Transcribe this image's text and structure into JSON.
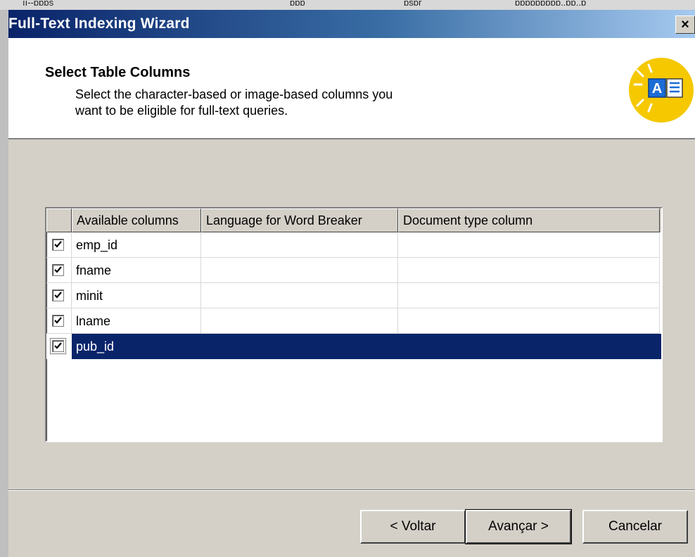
{
  "background_window": {
    "cells": [
      "ıı--ɒɒɒs",
      "ɒɒɒ",
      "ɒsɒr",
      "ɒɒɒɒɒɒɒɒɒ..ɒɒ..ɒ"
    ]
  },
  "window": {
    "title": "Full-Text Indexing Wizard",
    "close_label": "×"
  },
  "header": {
    "title": "Select Table Columns",
    "description_line1": "Select the character-based or image-based columns you",
    "description_line2": "want to be eligible for full-text queries.",
    "icon": "full-text-index-icon"
  },
  "columns_list": {
    "headers": [
      "Available columns",
      "Language for Word Breaker",
      "Document type column"
    ],
    "rows": [
      {
        "name": "emp_id",
        "checked": true
      },
      {
        "name": "fname",
        "checked": true
      },
      {
        "name": "minit",
        "checked": true
      },
      {
        "name": "lname",
        "checked": true
      },
      {
        "name": "pub_id",
        "checked": true,
        "selected": true
      }
    ]
  },
  "buttons": {
    "back": "< Voltar",
    "next": "Avançar >",
    "cancel": "Cancelar"
  },
  "colors": {
    "titlebar": "#0a246a",
    "selection": "#0a246a",
    "dialog_face": "#d4d0c8",
    "icon_yellow": "#f5c800",
    "icon_blue": "#1c6cd6"
  }
}
